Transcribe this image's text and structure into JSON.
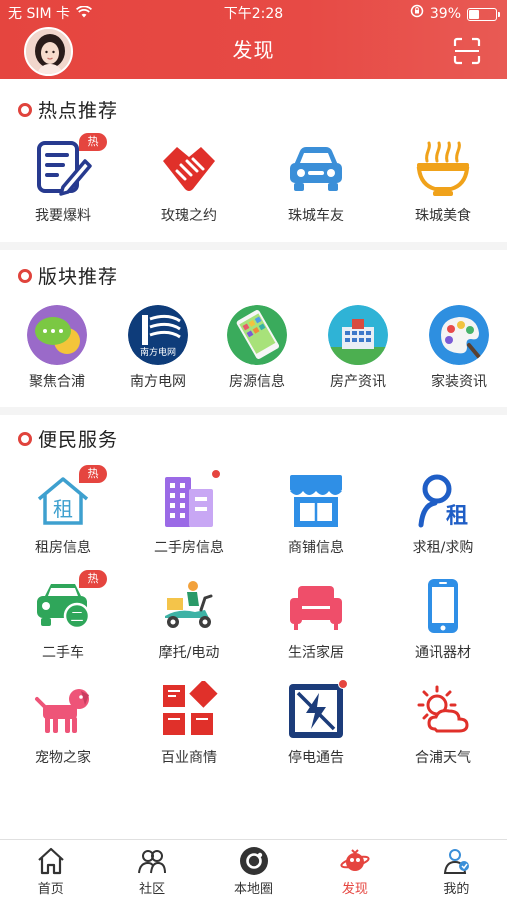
{
  "status_bar": {
    "carrier": "无 SIM 卡",
    "time": "下午2:28",
    "battery": "39%",
    "battery_level": 0.39
  },
  "header": {
    "title": "发现"
  },
  "hot": {
    "title": "热点推荐",
    "items": [
      {
        "label": "我要爆料",
        "icon": "edit-note-icon",
        "badge": "热"
      },
      {
        "label": "玫瑰之约",
        "icon": "handshake-icon"
      },
      {
        "label": "珠城车友",
        "icon": "car-icon"
      },
      {
        "label": "珠城美食",
        "icon": "noodle-bowl-icon"
      }
    ]
  },
  "boards": {
    "title": "版块推荐",
    "items": [
      {
        "label": "聚焦合浦",
        "icon": "chat-bubbles-icon"
      },
      {
        "label": "南方电网",
        "icon": "power-grid-logo-icon",
        "logo_text": "南方电网"
      },
      {
        "label": "房源信息",
        "icon": "phone-icon"
      },
      {
        "label": "房产资讯",
        "icon": "building-icon"
      },
      {
        "label": "家装资讯",
        "icon": "palette-icon"
      }
    ]
  },
  "services": {
    "title": "便民服务",
    "items": [
      {
        "label": "租房信息",
        "icon": "house-rent-icon",
        "badge": "热",
        "glyph": "租"
      },
      {
        "label": "二手房信息",
        "icon": "buildings-icon",
        "dot": true
      },
      {
        "label": "商铺信息",
        "icon": "shop-icon"
      },
      {
        "label": "求租/求购",
        "icon": "person-rent-icon",
        "glyph": "租"
      },
      {
        "label": "二手车",
        "icon": "used-car-icon",
        "badge": "热",
        "glyph": "二"
      },
      {
        "label": "摩托/电动",
        "icon": "scooter-icon"
      },
      {
        "label": "生活家居",
        "icon": "sofa-icon"
      },
      {
        "label": "通讯器材",
        "icon": "mobile-phone-icon"
      },
      {
        "label": "宠物之家",
        "icon": "dog-icon"
      },
      {
        "label": "百业商情",
        "icon": "business-blocks-icon"
      },
      {
        "label": "停电通告",
        "icon": "power-outage-icon",
        "dot": true
      },
      {
        "label": "合浦天气",
        "icon": "weather-icon"
      }
    ]
  },
  "tabbar": {
    "items": [
      {
        "label": "首页",
        "icon": "home-icon"
      },
      {
        "label": "社区",
        "icon": "community-icon"
      },
      {
        "label": "本地圈",
        "icon": "local-circle-icon"
      },
      {
        "label": "发现",
        "icon": "discover-icon",
        "active": true
      },
      {
        "label": "我的",
        "icon": "profile-icon"
      }
    ]
  },
  "colors": {
    "brand": "#e5453f",
    "hot_badge": "#e5453f"
  }
}
